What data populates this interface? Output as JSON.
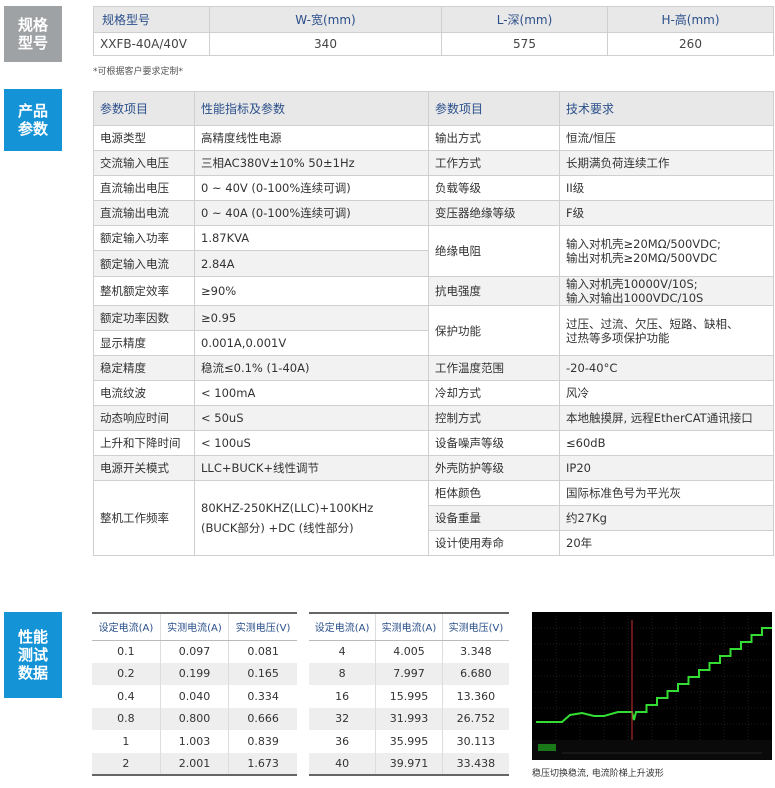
{
  "side_labels": {
    "model": "规格\n型号",
    "params": "产品\n参数",
    "test": "性能\n测试\n数据"
  },
  "model_table": {
    "headers": [
      "规格型号",
      "W-宽(mm)",
      "L-深(mm)",
      "H-高(mm)"
    ],
    "row": [
      "XXFB-40A/40V",
      "340",
      "575",
      "260"
    ],
    "note": "*可根据客户要求定制*"
  },
  "params_table": {
    "headers": [
      "参数项目",
      "性能指标及参数",
      "参数项目",
      "技术要求"
    ],
    "left_rows": [
      [
        "电源类型",
        "高精度线性电源"
      ],
      [
        "交流输入电压",
        "三相AC380V±10%   50±1Hz"
      ],
      [
        "直流输出电压",
        "0 ~ 40V  (0-100%连续可调)"
      ],
      [
        "直流输出电流",
        "0 ~ 40A  (0-100%连续可调)"
      ],
      [
        "额定输入功率",
        "1.87KVA"
      ],
      [
        "额定输入电流",
        "2.84A"
      ],
      [
        "整机额定效率",
        "≥90%"
      ],
      [
        "额定功率因数",
        "≥0.95"
      ],
      [
        "显示精度",
        "0.001A,0.001V"
      ],
      [
        "稳定精度",
        "稳流≤0.1%  (1-40A)"
      ],
      [
        "电流纹波",
        "< 100mA"
      ],
      [
        "动态响应时间",
        "< 50uS"
      ],
      [
        "上升和下降时间",
        "< 100uS"
      ],
      [
        "电源开关模式",
        "LLC+BUCK+线性调节"
      ],
      [
        "整机工作频率",
        "80KHZ-250KHZ(LLC)+100KHz\n(BUCK部分) +DC (线性部分)"
      ]
    ],
    "right_rows": [
      [
        "输出方式",
        "恒流/恒压"
      ],
      [
        "工作方式",
        "长期满负荷连续工作"
      ],
      [
        "负载等级",
        "II级"
      ],
      [
        "变压器绝缘等级",
        "F级"
      ],
      [
        "绝缘电阻",
        "输入对机壳≥20MΩ/500VDC;\n输出对机壳≥20MΩ/500VDC"
      ],
      [
        "抗电强度",
        "输入对机壳10000V/10S;\n输入对输出1000VDC/10S"
      ],
      [
        "保护功能",
        "过压、过流、欠压、短路、缺相、\n过热等多项保护功能"
      ],
      [
        "工作温度范围",
        "-20-40°C"
      ],
      [
        "冷却方式",
        "风冷"
      ],
      [
        "控制方式",
        "本地触摸屏, 远程EtherCAT通讯接口"
      ],
      [
        "设备噪声等级",
        "≤60dB"
      ],
      [
        "外壳防护等级",
        "IP20"
      ],
      [
        "柜体颜色",
        "国际标准色号为平光灰"
      ],
      [
        "设备重量",
        "约27Kg"
      ],
      [
        "设计使用寿命",
        "20年"
      ]
    ]
  },
  "test_tables": {
    "headers": [
      "设定电流(A)",
      "实测电流(A)",
      "实测电压(V)"
    ],
    "left": [
      [
        "0.1",
        "0.097",
        "0.081"
      ],
      [
        "0.2",
        "0.199",
        "0.165"
      ],
      [
        "0.4",
        "0.040",
        "0.334"
      ],
      [
        "0.8",
        "0.800",
        "0.666"
      ],
      [
        "1",
        "1.003",
        "0.839"
      ],
      [
        "2",
        "2.001",
        "1.673"
      ]
    ],
    "right": [
      [
        "4",
        "4.005",
        "3.348"
      ],
      [
        "8",
        "7.997",
        "6.680"
      ],
      [
        "16",
        "15.995",
        "13.360"
      ],
      [
        "32",
        "31.993",
        "26.752"
      ],
      [
        "36",
        "35.995",
        "30.113"
      ],
      [
        "40",
        "39.971",
        "33.438"
      ]
    ]
  },
  "scope": {
    "caption": "稳压切换稳流, 电流阶梯上升波形",
    "trace_color": "#33dd33",
    "step_levels": [
      0,
      1,
      2,
      3,
      4,
      5,
      6,
      7,
      8,
      9,
      10,
      11,
      12
    ]
  }
}
